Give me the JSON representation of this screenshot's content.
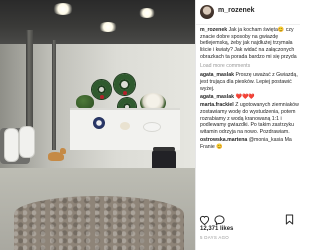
{
  "post": {
    "username": "m_rozenek",
    "caption_user": "m_rozenek",
    "caption_text": "Jak ja kocham święta😊 czy znacie dobre sposoby na gwiazdę betlejemską, żeby jak najdłużej trzymała liście i kwiaty? Jak widać na załączonych obrazkach ta porada bardzo mi się przyda",
    "load_more": "Load more comments"
  },
  "comments": [
    {
      "user": "agata_maslak",
      "text": "Proszę uważać z Gwiazdą, jest trująca dla piesków. Lepiej postawić wyżej."
    },
    {
      "user": "agata_maslak",
      "text": "❤️❤️❤️",
      "hearts": true
    },
    {
      "user": "marta.frackiel",
      "text": "Z ugotowanych ziemniaków zostawiamy wodę do wystudzenia, potem rozrabiamy z wodą kranowaną 1:1 i podlewamy gwiazdki. Po takim zastrzyku witamin odrzyja na nowo. Pozdrawiam."
    },
    {
      "user": "ostrowska.martena",
      "text": "@monia_kasia Ma Franie 😊"
    }
  ],
  "actions": {
    "like_icon": "heart-icon",
    "comment_icon": "comment-icon",
    "save_icon": "bookmark-icon"
  },
  "likes": "12,371 likes",
  "date": "5 DAYS AGO",
  "colors": {
    "text": "#262626",
    "muted": "#999999",
    "heart": "#e0242d"
  }
}
